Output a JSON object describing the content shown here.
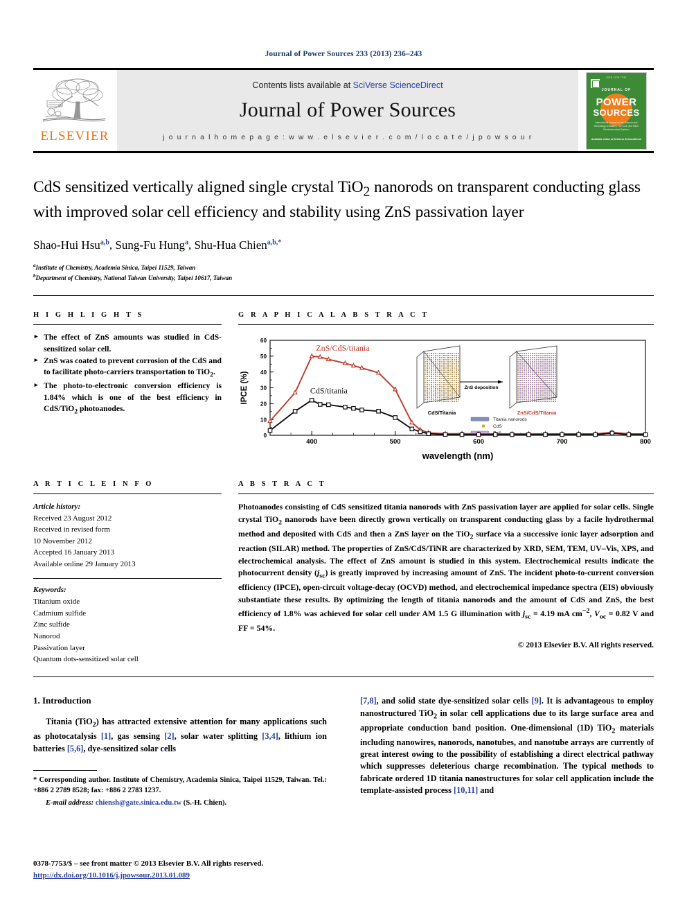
{
  "running_head": "Journal of Power Sources 233 (2013) 236–243",
  "masthead": {
    "publisher_name": "ELSEVIER",
    "contents_prefix": "Contents lists available at ",
    "contents_link": "SciVerse ScienceDirect",
    "journal_name": "Journal of Power Sources",
    "homepage": "j o u r n a l   h o m e p a g e :   w w w . e l s e v i e r . c o m / l o c a t e / j p o w s o u r",
    "cover": {
      "top_line": "ISSN 0378-7753",
      "journal_of": "JOURNAL OF",
      "power": "POWER",
      "sources": "SOURCES",
      "subtitle": "International Journal on the Science and Technology of Battery, Fuel Cell, and Other Electrochemical Systems",
      "footer": "Available online at\nSciVerse ScienceDirect"
    }
  },
  "article": {
    "title": "CdS sensitized vertically aligned single crystal TiO₂ nanorods on transparent conducting glass with improved solar cell efficiency and stability using ZnS passivation layer",
    "authors_html": "Shao-Hui Hsu, Sung-Fu Hung, Shu-Hua Chien",
    "author_list": [
      {
        "name": "Shao-Hui Hsu",
        "marks": "a,b"
      },
      {
        "name": "Sung-Fu Hung",
        "marks": "a"
      },
      {
        "name": "Shu-Hua Chien",
        "marks": "a,b,*"
      }
    ],
    "affiliations": [
      {
        "mark": "a",
        "text": "Institute of Chemistry, Academia Sinica, Taipei 11529, Taiwan"
      },
      {
        "mark": "b",
        "text": "Department of Chemistry, National Taiwan University, Taipei 10617, Taiwan"
      }
    ]
  },
  "highlights": {
    "heading": "H I G H L I G H T S",
    "items": [
      "The effect of ZnS amounts was studied in CdS-sensitized solar cell.",
      "ZnS was coated to prevent corrosion of the CdS and to facilitate photo-carriers transportation to TiO₂.",
      "The photo-to-electronic conversion efficiency is 1.84% which is one of the best efficiency in CdS/TiO₂ photoanodes."
    ]
  },
  "graphical_abstract": {
    "heading": "G R A P H I C A L   A B S T R A C T"
  },
  "chart_data": {
    "type": "line",
    "title": "",
    "xlabel": "wavelength (nm)",
    "ylabel": "IPCE (%)",
    "xlim": [
      350,
      800
    ],
    "ylim": [
      0,
      60
    ],
    "xticks": [
      400,
      500,
      600,
      700,
      800
    ],
    "yticks": [
      0,
      10,
      20,
      30,
      40,
      50,
      60
    ],
    "grid": false,
    "legend_position": "inline-annotations",
    "series": [
      {
        "name": "ZnS/CdS/titania",
        "color": "#C0392B",
        "marker": "triangle-up-open",
        "x": [
          350,
          380,
          400,
          410,
          420,
          440,
          450,
          460,
          480,
          500,
          520,
          530,
          540,
          560,
          580,
          600,
          620,
          640,
          660,
          680,
          700,
          720,
          740,
          760,
          780,
          800
        ],
        "y": [
          9.0,
          27.0,
          50.0,
          49.5,
          48.0,
          45.5,
          44.0,
          42.5,
          39.5,
          29.0,
          8.0,
          3.5,
          1.5,
          1.0,
          1.0,
          0.9,
          0.9,
          0.9,
          0.9,
          0.9,
          0.9,
          0.9,
          0.9,
          1.8,
          0.9,
          0.9
        ]
      },
      {
        "name": "CdS/titania",
        "color": "#111111",
        "marker": "square-open",
        "x": [
          350,
          380,
          400,
          410,
          420,
          440,
          450,
          460,
          480,
          500,
          520,
          530,
          540,
          560,
          580,
          600,
          620,
          640,
          660,
          680,
          700,
          720,
          740,
          760,
          780,
          800
        ],
        "y": [
          3.0,
          15.2,
          22.2,
          19.5,
          19.3,
          17.8,
          17.0,
          16.0,
          15.2,
          11.2,
          4.0,
          2.2,
          1.0,
          0.5,
          0.4,
          0.4,
          0.4,
          0.4,
          0.4,
          0.4,
          0.4,
          0.4,
          0.4,
          1.4,
          0.4,
          0.4
        ]
      }
    ],
    "annotations": [
      {
        "text": "ZnS/CdS/titania",
        "color": "#C0392B"
      },
      {
        "text": "CdS/titania",
        "color": "#111111"
      }
    ],
    "inset": {
      "left_label": "CdS/Titania",
      "right_label": "ZnS/CdS/Titania",
      "arrow_label": "ZnS deposition",
      "legend": [
        {
          "label": "Titania nanorods",
          "color": "#7f8fbf"
        },
        {
          "label": "CdS",
          "color": "#d9a441"
        },
        {
          "label": "ZnS",
          "color": "#d9a8e8"
        }
      ]
    }
  },
  "article_info": {
    "heading": "A R T I C L E   I N F O",
    "history_label": "Article history:",
    "history": [
      "Received 23 August 2012",
      "Received in revised form",
      "10 November 2012",
      "Accepted 16 January 2013",
      "Available online 29 January 2013"
    ],
    "keywords_label": "Keywords:",
    "keywords": [
      "Titanium oxide",
      "Cadmium sulfide",
      "Zinc sulfide",
      "Nanorod",
      "Passivation layer",
      "Quantum dots-sensitized solar cell"
    ]
  },
  "abstract": {
    "heading": "A B S T R A C T",
    "body": "Photoanodes consisting of CdS sensitized titania nanorods with ZnS passivation layer are applied for solar cells. Single crystal TiO₂ nanorods have been directly grown vertically on transparent conducting glass by a facile hydrothermal method and deposited with CdS and then a ZnS layer on the TiO₂ surface via a successive ionic layer adsorption and reaction (SILAR) method. The properties of ZnS/CdS/TiNR are characterized by XRD, SEM, TEM, UV–Vis, XPS, and electrochemical analysis. The effect of ZnS amount is studied in this system. Electrochemical results indicate the photocurrent density (jₛᴄ) is greatly improved by increasing amount of ZnS. The incident photo-to-current conversion efficiency (IPCE), open-circuit voltage-decay (OCVD) method, and electrochemical impedance spectra (EIS) obviously substantiate these results. By optimizing the length of titania nanorods and the amount of CdS and ZnS, the best efficiency of 1.8% was achieved for solar cell under AM 1.5 G illumination with jₛᴄ = 4.19 mA cm⁻², Vₒᴄ = 0.82 V and FF = 54%.",
    "copyright": "© 2013 Elsevier B.V. All rights reserved."
  },
  "body": {
    "section_number_title": "1.  Introduction",
    "para_left": "Titania (TiO₂) has attracted extensive attention for many applications such as photocatalysis [1], gas sensing [2], solar water splitting [3,4], lithium ion batteries [5,6], dye-sensitized solar cells",
    "para_right": "[7,8], and solid state dye-sensitized solar cells [9]. It is advantageous to employ nanostructured TiO₂ in solar cell applications due to its large surface area and appropriate conduction band position. One-dimensional (1D) TiO₂ materials including nanowires, nanorods, nanotubes, and nanotube arrays are currently of great interest owing to the possibility of establishing a direct electrical pathway which suppresses deleterious charge recombination. The typical methods to fabricate ordered 1D titania nanostructures for solar cell application include the template-assisted process [10,11] and"
  },
  "footnote": {
    "corresponding": "* Corresponding author. Institute of Chemistry, Academia Sinica, Taipei 11529, Taiwan. Tel.: +886 2 2789 8528; fax: +886 2 2783 1237.",
    "email_label": "E-mail address:",
    "email": "chiensh@gate.sinica.edu.tw",
    "email_suffix": " (S.-H. Chien)."
  },
  "bottom": {
    "issn_line": "0378-7753/$ – see front matter © 2013 Elsevier B.V. All rights reserved.",
    "doi": "http://dx.doi.org/10.1016/j.jpowsour.2013.01.089"
  }
}
